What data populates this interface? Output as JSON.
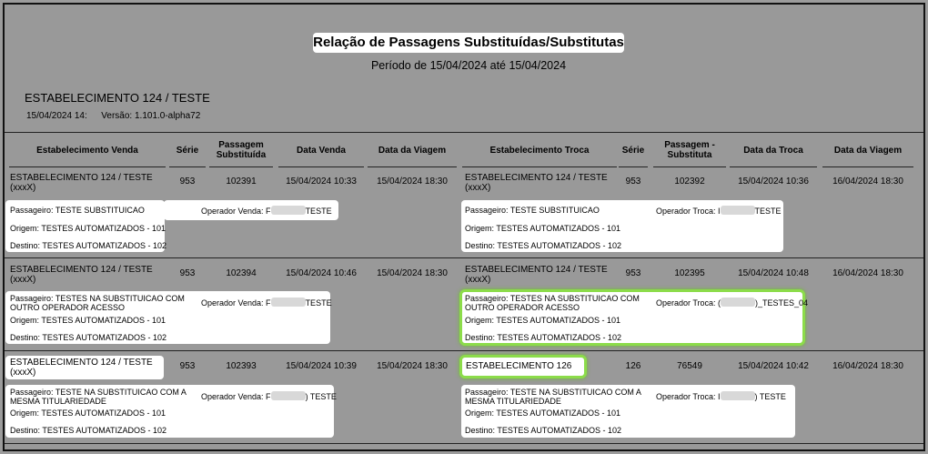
{
  "report": {
    "title": "Relação de Passagens Substituídas/Substitutas",
    "period": "Período de 15/04/2024 até 15/04/2024",
    "establishment": "ESTABELECIMENTO 124 / TESTE",
    "date_time": "15/04/2024 14:",
    "version": "Versão: 1.101.0-alpha72"
  },
  "headers": {
    "estab_venda": "Estabelecimento Venda",
    "serie": "Série",
    "passagem_substituida": "Passagem Substituída",
    "data_venda": "Data Venda",
    "data_viagem": "Data da Viagem",
    "estab_troca": "Estabelecimento Troca",
    "serie2": "Série",
    "passagem_substituta": "Passagem - Substituta",
    "data_troca": "Data da Troca",
    "data_viagem2": "Data da Viagem"
  },
  "rows": [
    {
      "estab_venda_line1": "ESTABELECIMENTO 124 / TESTE",
      "estab_venda_line2": "(xxxX)",
      "serie": "953",
      "passagem": "102391",
      "data_venda": "15/04/2024 10:33",
      "data_viagem": "15/04/2024 18:30",
      "estab_troca_line1": "ESTABELECIMENTO 124 / TESTE",
      "estab_troca_line2": "(xxxX)",
      "serie_troca": "953",
      "passagem_troca": "102392",
      "data_troca": "15/04/2024 10:36",
      "data_viagem_troca": "16/04/2024 18:30",
      "left": {
        "passageiro1": "Passageiro: TESTE SUBSTITUICAO",
        "passageiro2": "",
        "origem": "Origem: TESTES AUTOMATIZADOS - 101",
        "destino": "Destino: TESTES AUTOMATIZADOS - 102",
        "operador_label": "Operador Venda: F",
        "operador_suffix": "TESTE"
      },
      "right": {
        "passageiro1": "Passageiro: TESTE SUBSTITUICAO",
        "passageiro2": "",
        "origem": "Origem: TESTES AUTOMATIZADOS - 101",
        "destino": "Destino: TESTES AUTOMATIZADOS - 102",
        "operador_label": "Operador Troca: I",
        "operador_suffix": "TESTE"
      }
    },
    {
      "estab_venda_line1": "ESTABELECIMENTO 124 / TESTE",
      "estab_venda_line2": "(xxxX)",
      "serie": "953",
      "passagem": "102394",
      "data_venda": "15/04/2024 10:46",
      "data_viagem": "15/04/2024 18:30",
      "estab_troca_line1": "ESTABELECIMENTO 124 / TESTE",
      "estab_troca_line2": "(xxxX)",
      "serie_troca": "953",
      "passagem_troca": "102395",
      "data_troca": "15/04/2024 10:48",
      "data_viagem_troca": "16/04/2024 18:30",
      "left": {
        "passageiro1": "Passageiro: TESTES NA SUBSTITUICAO COM",
        "passageiro2": "OUTRO OPERADOR  ACESSO",
        "origem": "Origem: TESTES AUTOMATIZADOS - 101",
        "destino": "Destino: TESTES AUTOMATIZADOS - 102",
        "operador_label": "Operador Venda: F",
        "operador_suffix": "TESTE"
      },
      "right": {
        "passageiro1": "Passageiro: TESTES NA SUBSTITUICAO COM",
        "passageiro2": "OUTRO OPERADOR  ACESSO",
        "origem": "Origem: TESTES AUTOMATIZADOS - 101",
        "destino": "Destino: TESTES AUTOMATIZADOS - 102",
        "operador_label": "Operador Troca: (",
        "operador_suffix": ")_TESTES_04"
      }
    },
    {
      "estab_venda_line1": "ESTABELECIMENTO 124 / TESTE",
      "estab_venda_line2": "(xxxX)",
      "serie": "953",
      "passagem": "102393",
      "data_venda": "15/04/2024 10:39",
      "data_viagem": "15/04/2024 18:30",
      "estab_troca_line1": "ESTABELECIMENTO 126",
      "estab_troca_line2": "",
      "serie_troca": "126",
      "passagem_troca": "76549",
      "data_troca": "15/04/2024 10:42",
      "data_viagem_troca": "16/04/2024 18:30",
      "left": {
        "passageiro1": "Passageiro: TESTE NA SUBSTITUICAO COM A",
        "passageiro2": "MESMA TITULARIEDADE",
        "origem": "Origem: TESTES AUTOMATIZADOS - 101",
        "destino": "Destino: TESTES AUTOMATIZADOS - 102",
        "operador_label": "Operador Venda: F",
        "operador_suffix": ") TESTE"
      },
      "right": {
        "passageiro1": "Passageiro: TESTE NA SUBSTITUICAO COM A",
        "passageiro2": "MESMA TITULARIEDADE",
        "origem": "Origem: TESTES AUTOMATIZADOS - 101",
        "destino": "Destino: TESTES AUTOMATIZADOS - 102",
        "operador_label": "Operador Troca: I",
        "operador_suffix": ") TESTE"
      }
    }
  ],
  "colors": {
    "background": "#999999",
    "highlight": "#8cdc4a"
  }
}
